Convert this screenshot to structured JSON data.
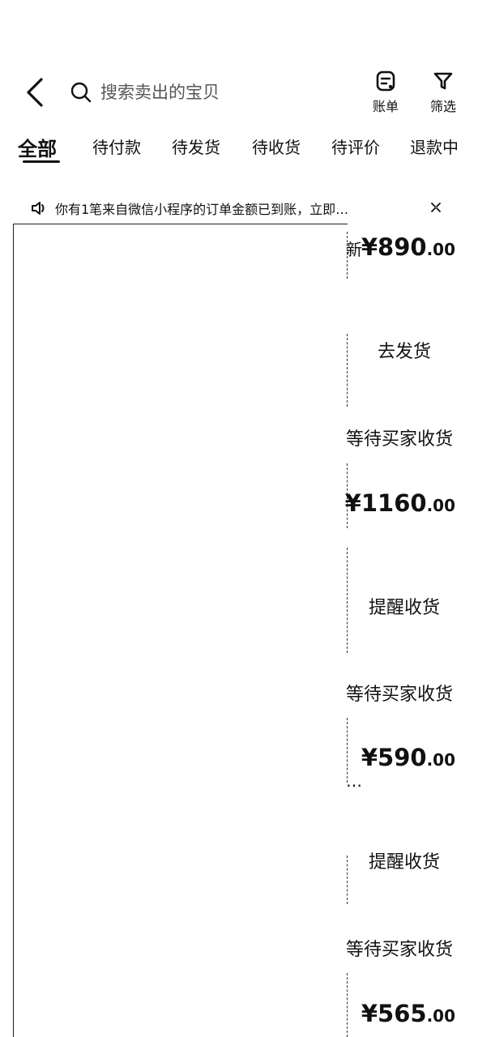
{
  "header": {
    "search_placeholder": "搜索卖出的宝贝",
    "bill_label": "账单",
    "filter_label": "筛选"
  },
  "tabs": [
    {
      "label": "全部",
      "active": true
    },
    {
      "label": "待付款"
    },
    {
      "label": "待发货"
    },
    {
      "label": "待收货"
    },
    {
      "label": "待评价"
    },
    {
      "label": "退款中"
    }
  ],
  "notice": {
    "text": "你有1笔来自微信小程序的订单金额已到账，立即…"
  },
  "orders": [
    {
      "title_fragment": "新",
      "price_int": "¥890",
      "price_dec": ".00",
      "action": "去发货"
    },
    {
      "status": "等待买家收货",
      "price_int": "¥1160",
      "price_dec": ".00",
      "action": "提醒收货"
    },
    {
      "status": "等待买家收货",
      "price_int": "¥590",
      "price_dec": ".00",
      "title_fragment": "…",
      "action": "提醒收货"
    },
    {
      "status": "等待买家收货",
      "price_int": "¥565",
      "price_dec": ".00"
    }
  ]
}
